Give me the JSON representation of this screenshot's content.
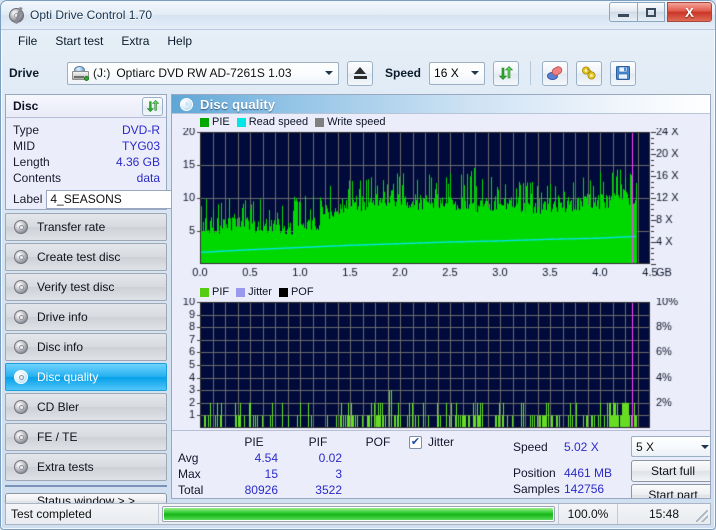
{
  "window": {
    "title": "Opti Drive Control 1.70",
    "app_icon": "disc-icon",
    "minimize_label": "",
    "maximize_label": "",
    "close_label": "X"
  },
  "menu": {
    "items": [
      {
        "label": "File"
      },
      {
        "label": "Start test"
      },
      {
        "label": "Extra"
      },
      {
        "label": "Help"
      }
    ]
  },
  "toolbar": {
    "drive_label": "Drive",
    "drive_letter": "(J:)",
    "drive_value": "Optiarc DVD RW AD-7261S 1.03",
    "eject_icon": "eject-icon",
    "speed_label": "Speed",
    "speed_value": "16 X",
    "refresh_icon": "refresh-icon",
    "erase_icon": "erase-disc-icon",
    "settings_icon": "settings-plug-icon",
    "save_icon": "save-floppy-icon"
  },
  "disc_panel": {
    "title": "Disc",
    "refresh_icon": "refresh-icon",
    "rows": [
      {
        "key": "Type",
        "value": "DVD-R"
      },
      {
        "key": "MID",
        "value": "TYG03"
      },
      {
        "key": "Length",
        "value": "4.36 GB"
      },
      {
        "key": "Contents",
        "value": "data"
      }
    ],
    "label_key": "Label",
    "label_value": "4_SEASONS",
    "label_icon": "disc-gold-icon"
  },
  "sidebar": {
    "items": [
      {
        "label": "Transfer rate",
        "icon": "disc-icon",
        "active": false
      },
      {
        "label": "Create test disc",
        "icon": "disc-icon",
        "active": false
      },
      {
        "label": "Verify test disc",
        "icon": "disc-icon",
        "active": false
      },
      {
        "label": "Drive info",
        "icon": "disc-icon",
        "active": false
      },
      {
        "label": "Disc info",
        "icon": "disc-icon",
        "active": false
      },
      {
        "label": "Disc quality",
        "icon": "disc-icon",
        "active": true
      },
      {
        "label": "CD Bler",
        "icon": "disc-icon",
        "active": false
      },
      {
        "label": "FE / TE",
        "icon": "disc-icon",
        "active": false
      },
      {
        "label": "Extra tests",
        "icon": "disc-icon",
        "active": false
      }
    ],
    "status_window_button": "Status window > >"
  },
  "panel": {
    "title": "Disc quality",
    "icon": "disc-icon"
  },
  "stats": {
    "col_headers": [
      "PIE",
      "PIF",
      "POF"
    ],
    "jitter_label": "Jitter",
    "jitter_checked": true,
    "rows": [
      {
        "name": "Avg",
        "pie": "4.54",
        "pif": "0.02",
        "pof": ""
      },
      {
        "name": "Max",
        "pie": "15",
        "pif": "3",
        "pof": ""
      },
      {
        "name": "Total",
        "pie": "80926",
        "pif": "3522",
        "pof": ""
      }
    ],
    "speed_label": "Speed",
    "speed_value": "5.02 X",
    "position_label": "Position",
    "position_value": "4461 MB",
    "samples_label": "Samples",
    "samples_value": "142756",
    "speed_select_value": "5 X",
    "start_full_label": "Start full",
    "start_part_label": "Start part"
  },
  "statusbar": {
    "message": "Test completed",
    "progress_text": "100.0%",
    "progress_percent": 100,
    "time": "15:48"
  },
  "colors": {
    "pie_green": "#00d900",
    "read_speed_cyan": "#00e5e5",
    "write_speed_gray": "#808080",
    "pif_green": "#66dd22",
    "jitter_violet": "#9999ee",
    "pof_black": "#000000",
    "plot_bg": "#000b3c",
    "accent_blue": "#05a0e8",
    "value_blue": "#2b2bc8",
    "marker_magenta": "#ff00ff"
  },
  "chart_data": [
    {
      "type": "area",
      "name": "Disc quality - PIE / Read speed",
      "title": "Disc quality",
      "legend": [
        {
          "label": "PIE",
          "color": "#00b000"
        },
        {
          "label": "Read speed",
          "color": "#00e5e5"
        },
        {
          "label": "Write speed",
          "color": "#808080"
        }
      ],
      "legend_position": "top-left",
      "xlabel": "GB",
      "ylabel": "PIE",
      "y2label": "X",
      "xlim": [
        0.0,
        4.5
      ],
      "ylim": [
        0,
        20
      ],
      "y2lim": [
        0,
        24
      ],
      "xticks": [
        0.0,
        0.5,
        1.0,
        1.5,
        2.0,
        2.5,
        3.0,
        3.5,
        4.0,
        4.5
      ],
      "xticklabels": [
        "0.0",
        "0.5",
        "1.0",
        "1.5",
        "2.0",
        "2.5",
        "3.0",
        "3.5",
        "4.0",
        "4.5"
      ],
      "x_axis_unit": "GB",
      "yticks": [
        5,
        10,
        15,
        20
      ],
      "yticklabels": [
        "5",
        "10",
        "15",
        "20"
      ],
      "y2ticks": [
        4,
        8,
        12,
        16,
        20,
        24
      ],
      "y2ticklabels": [
        "4 X",
        "8 X",
        "12 X",
        "16 X",
        "20 X",
        "24 X"
      ],
      "grid": true,
      "data_end_x": 4.36,
      "marker_x": 4.32,
      "series": [
        {
          "name": "PIE",
          "color": "#00d900",
          "type": "spike-area",
          "avg": 4.54,
          "max": 15,
          "total": 80926,
          "envelope_x": [
            0.0,
            0.2,
            0.4,
            0.6,
            0.8,
            1.0,
            1.2,
            1.35,
            1.5,
            1.7,
            1.9,
            2.0,
            2.2,
            2.4,
            2.6,
            2.8,
            3.0,
            3.2,
            3.4,
            3.6,
            3.8,
            4.0,
            4.2,
            4.36
          ],
          "envelope_top": [
            7.0,
            6.5,
            6.8,
            6.6,
            6.4,
            6.6,
            6.8,
            9.5,
            10.0,
            10.2,
            11.0,
            10.5,
            10.3,
            10.4,
            10.2,
            10.0,
            10.2,
            10.0,
            9.8,
            10.0,
            10.2,
            10.5,
            11.0,
            11.2
          ],
          "spike_max": [
            10.0,
            9.5,
            10.0,
            9.8,
            9.6,
            10.0,
            10.2,
            12.8,
            12.5,
            13.0,
            14.2,
            13.5,
            14.0,
            13.8,
            13.5,
            15.0,
            13.2,
            12.5,
            13.0,
            13.5,
            14.0,
            14.5,
            14.2,
            13.0
          ]
        },
        {
          "name": "Read speed",
          "color": "#00e5e5",
          "type": "line",
          "y2_x": [
            0.0,
            0.5,
            1.0,
            1.5,
            2.0,
            2.5,
            3.0,
            3.5,
            4.0,
            4.36
          ],
          "y2_values": [
            2.1,
            2.6,
            3.0,
            3.4,
            3.7,
            4.0,
            4.2,
            4.5,
            4.7,
            5.02
          ]
        },
        {
          "name": "Write speed",
          "color": "#808080",
          "type": "line",
          "y2_x": [],
          "y2_values": []
        }
      ]
    },
    {
      "type": "bar",
      "name": "Disc quality - PIF / Jitter / POF",
      "legend": [
        {
          "label": "PIF",
          "color": "#66dd22"
        },
        {
          "label": "Jitter",
          "color": "#9999ee"
        },
        {
          "label": "POF",
          "color": "#000000"
        }
      ],
      "legend_position": "top-left",
      "xlabel": "GB",
      "ylabel": "PIF",
      "y2label": "%",
      "xlim": [
        0.0,
        4.5
      ],
      "ylim": [
        0,
        10
      ],
      "y2lim": [
        0,
        10
      ],
      "xticks": [
        0.0,
        0.5,
        1.0,
        1.5,
        2.0,
        2.5,
        3.0,
        3.5,
        4.0,
        4.5
      ],
      "xticklabels": [
        "0.0",
        "0.5",
        "1.0",
        "1.5",
        "2.0",
        "2.5",
        "3.0",
        "3.5",
        "4.0",
        "4.5"
      ],
      "x_axis_unit": "GB",
      "yticks": [
        1,
        2,
        3,
        4,
        5,
        6,
        7,
        8,
        9,
        10
      ],
      "yticklabels": [
        "1",
        "2",
        "3",
        "4",
        "5",
        "6",
        "7",
        "8",
        "9",
        "10"
      ],
      "y2ticks": [
        2,
        4,
        6,
        8,
        10
      ],
      "y2ticklabels": [
        "2%",
        "4%",
        "6%",
        "8%",
        "10%"
      ],
      "grid": true,
      "data_end_x": 4.36,
      "marker_x": 4.32,
      "series": [
        {
          "name": "PIF",
          "color": "#66dd22",
          "avg": 0.02,
          "max": 3,
          "total": 3522,
          "note": "sparse spikes mostly 1-2, a few reaching 3 near 0.9, 1.6 and 1.9 GB; dense cluster of 2s around 4.1-4.3 GB"
        }
      ]
    }
  ]
}
